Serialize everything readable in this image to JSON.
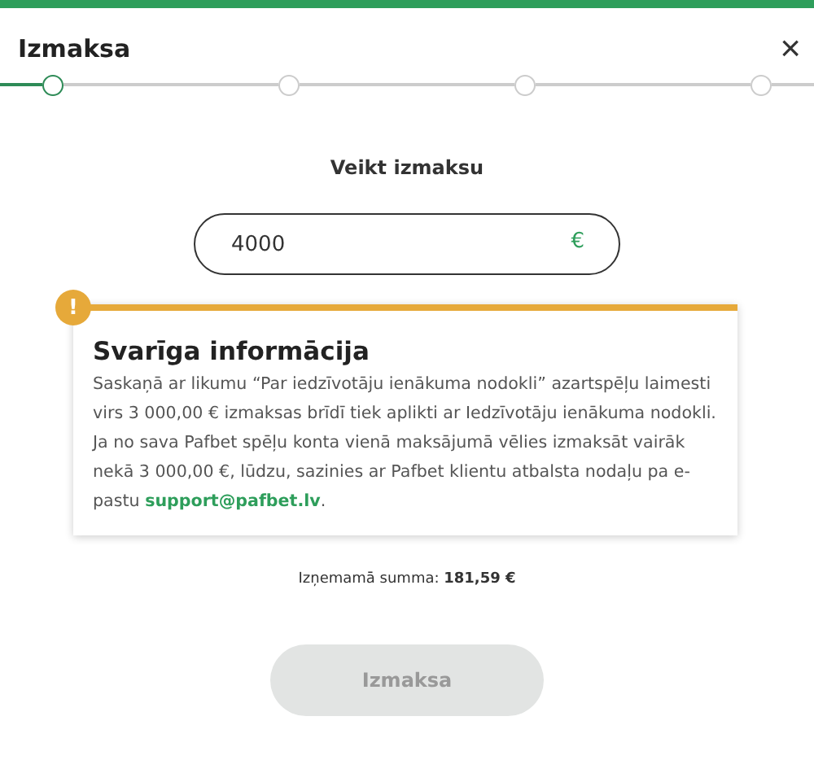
{
  "title": "Izmaksa",
  "close": "×",
  "steps": [
    {
      "active": true
    },
    {
      "active": false
    },
    {
      "active": false
    },
    {
      "active": false
    }
  ],
  "heading": "Veikt izmaksu",
  "amount_field": {
    "value": "4000",
    "currency": "€"
  },
  "notice": {
    "icon": "!",
    "title": "Svarīga informācija",
    "text_before": "Saskaņā ar likumu “Par iedzīvotāju ienākuma nodokli” azartspēļu laimesti virs 3 000,00 € izmaksas brīdī tiek aplikti ar Iedzīvotāju ienākuma nodokli. Ja no sava Pafbet spēļu konta vienā maksājumā vēlies izmaksāt vairāk nekā 3 000,00 €, lūdzu, sazinies ar Pafbet klientu atbalsta nodaļu pa e-pastu ",
    "link": "support@pafbet.lv",
    "text_after": "."
  },
  "summary": {
    "label": "Izņemamā summa: ",
    "amount": "181,59 €"
  },
  "submit": {
    "label": "Izmaksa",
    "disabled": true
  }
}
